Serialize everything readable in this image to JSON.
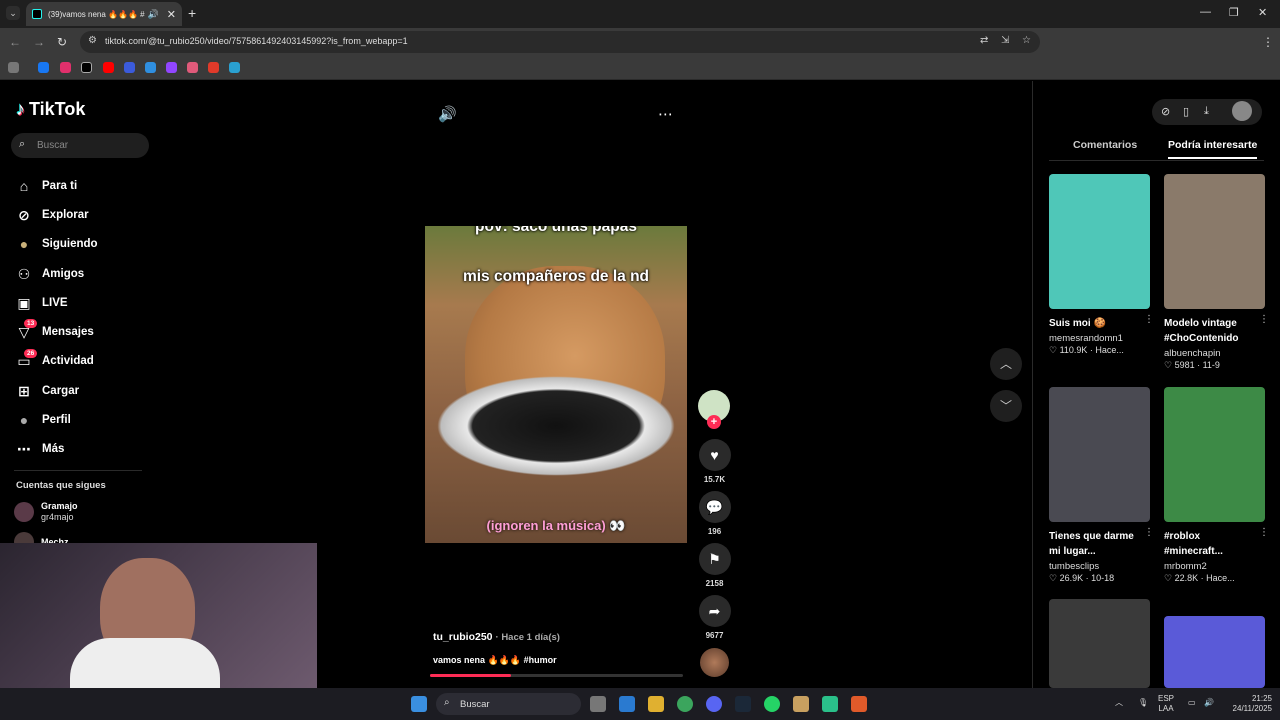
{
  "browser": {
    "tab_title": "(39)vamos nena 🔥🔥🔥 #",
    "url": "tiktok.com/@tu_rubio250/video/7575861492403145992?is_from_webapp=1"
  },
  "sidebar": {
    "logo": "TikTok",
    "search_placeholder": "Buscar",
    "items": [
      {
        "label": "Para ti",
        "icon": "⌂"
      },
      {
        "label": "Explorar",
        "icon": "⊘"
      },
      {
        "label": "Siguiendo",
        "icon": "●"
      },
      {
        "label": "Amigos",
        "icon": "⚇"
      },
      {
        "label": "LIVE",
        "icon": "▣"
      },
      {
        "label": "Mensajes",
        "icon": "▽",
        "badge": "13"
      },
      {
        "label": "Actividad",
        "icon": "▭",
        "badge": "26"
      },
      {
        "label": "Cargar",
        "icon": "⊞"
      },
      {
        "label": "Perfil",
        "icon": "●"
      },
      {
        "label": "Más",
        "icon": "⋯"
      }
    ],
    "following_title": "Cuentas que sigues",
    "accounts": [
      {
        "name": "Gramajo",
        "handle": "gr4majo"
      },
      {
        "name": "Mechz",
        "handle": ""
      }
    ]
  },
  "video": {
    "caption_line1": "pov: saco unas papas",
    "caption_line2": "mis compañeros de la nd",
    "caption_bottom": "(ignoren la música) 👀",
    "username": "tu_rubio250",
    "posted": "· Hace 1 día(s)",
    "description": "vamos nena 🔥🔥🔥 #humor",
    "progress": 0.32
  },
  "actions": {
    "likes": "15.7K",
    "comments": "196",
    "saves": "2158",
    "shares": "9677"
  },
  "right_panel": {
    "tab_comments": "Comentarios",
    "tab_suggested": "Podría interesarte",
    "cards": [
      {
        "title": "Suis moi 🍪",
        "title2": "",
        "author": "memesrandomn1",
        "stats": "♡ 110.9K · Hace...",
        "thumb_color": "#4fc7b8"
      },
      {
        "title": "Modelo vintage",
        "title2": "#ChoContenido",
        "author": "albuenchapin",
        "stats": "♡ 5981 · 11-9",
        "thumb_color": "#8a7a6a"
      },
      {
        "title": "Tienes que darme",
        "title2": "mi lugar...",
        "author": "tumbesclips",
        "stats": "♡ 26.9K · 10-18",
        "thumb_color": "#4a4a52"
      },
      {
        "title": "#roblox",
        "title2": "#minecraft...",
        "author": "mrbomm2",
        "stats": "♡ 22.8K · Hace...",
        "thumb_color": "#3d8a46"
      },
      {
        "title": "",
        "title2": "",
        "author": "",
        "stats": "",
        "thumb_color": "#3a3a3a"
      },
      {
        "title": "",
        "title2": "",
        "author": "",
        "stats": "",
        "thumb_color": "#5a5ad8"
      }
    ]
  },
  "taskbar": {
    "search": "Buscar",
    "lang": "ESP",
    "lang2": "LAA",
    "time": "21:25",
    "date": "24/11/2025"
  }
}
